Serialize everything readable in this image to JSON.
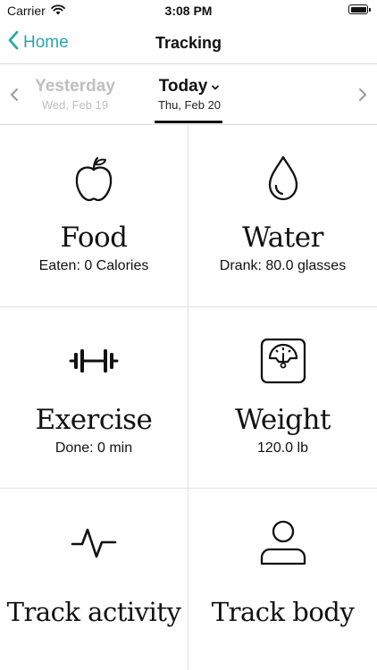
{
  "status_bar": {
    "carrier": "Carrier",
    "time": "3:08 PM",
    "icons": [
      "wifi-icon",
      "battery-icon"
    ]
  },
  "nav": {
    "back_label": "Home",
    "title": "Tracking",
    "accent_color": "#2aa6a8"
  },
  "date_selector": {
    "previous": {
      "label": "Yesterday",
      "date": "Wed, Feb 19"
    },
    "current": {
      "label": "Today",
      "date": "Thu, Feb 20"
    }
  },
  "tiles": [
    {
      "id": "food",
      "icon": "apple-icon",
      "title": "Food",
      "subtitle": "Eaten: 0 Calories"
    },
    {
      "id": "water",
      "icon": "water-drop-icon",
      "title": "Water",
      "subtitle": "Drank: 80.0 glasses"
    },
    {
      "id": "exercise",
      "icon": "dumbbell-icon",
      "title": "Exercise",
      "subtitle": "Done: 0 min"
    },
    {
      "id": "weight",
      "icon": "scale-icon",
      "title": "Weight",
      "subtitle": "120.0 lb"
    },
    {
      "id": "activity",
      "icon": "activity-pulse-icon",
      "title": "Track activity",
      "subtitle": ""
    },
    {
      "id": "body",
      "icon": "person-icon",
      "title": "Track body",
      "subtitle": ""
    }
  ]
}
